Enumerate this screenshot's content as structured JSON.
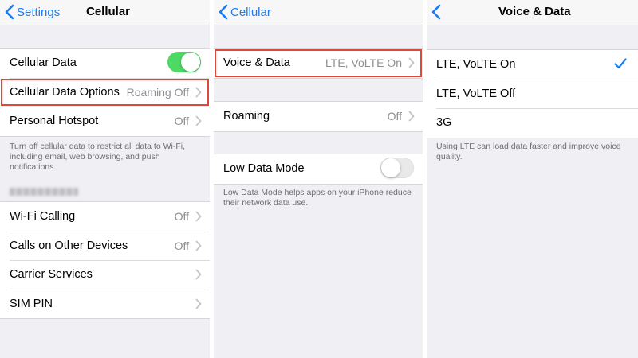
{
  "colors": {
    "accent": "#1a7cf4",
    "toggle_on": "#4cd964",
    "highlight": "#e0473b"
  },
  "panel1": {
    "back_label": "Settings",
    "title": "Cellular",
    "cellular_data": {
      "label": "Cellular Data",
      "enabled": true
    },
    "options": {
      "label": "Cellular Data Options",
      "value": "Roaming Off"
    },
    "hotspot": {
      "label": "Personal Hotspot",
      "value": "Off"
    },
    "footnote": "Turn off cellular data to restrict all data to Wi-Fi, including email, web browsing, and push notifications.",
    "wifi_calling": {
      "label": "Wi-Fi Calling",
      "value": "Off"
    },
    "calls_other": {
      "label": "Calls on Other Devices",
      "value": "Off"
    },
    "carrier": {
      "label": "Carrier Services"
    },
    "sim_pin": {
      "label": "SIM PIN"
    }
  },
  "panel2": {
    "back_label": "Cellular",
    "voice_data": {
      "label": "Voice & Data",
      "value": "LTE, VoLTE On"
    },
    "roaming": {
      "label": "Roaming",
      "value": "Off"
    },
    "low_data": {
      "label": "Low Data Mode",
      "enabled": false
    },
    "footnote": "Low Data Mode helps apps on your iPhone reduce their network data use."
  },
  "panel3": {
    "title": "Voice & Data",
    "options": [
      "LTE, VoLTE On",
      "LTE, VoLTE Off",
      "3G"
    ],
    "selected": "LTE, VoLTE On",
    "footnote": "Using LTE can load data faster and improve voice quality."
  }
}
